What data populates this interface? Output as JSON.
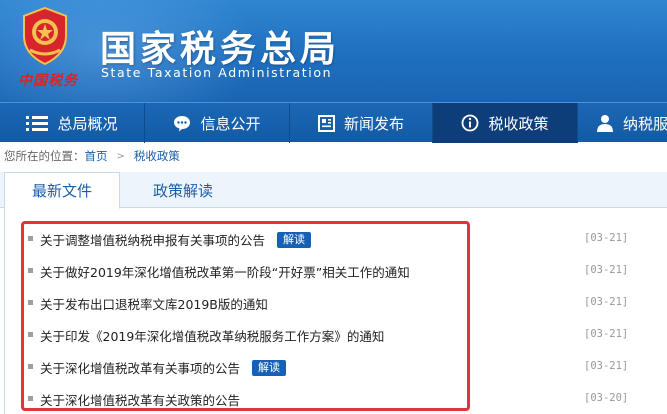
{
  "header": {
    "title": "国家税务总局",
    "subtitle": "State Taxation Administration",
    "emblem_script": "中国税务"
  },
  "nav": {
    "items": [
      {
        "label": "总局概况",
        "icon": "menu-list-icon"
      },
      {
        "label": "信息公开",
        "icon": "chat-bubble-icon"
      },
      {
        "label": "新闻发布",
        "icon": "newspaper-icon"
      },
      {
        "label": "税收政策",
        "icon": "info-circle-icon",
        "active": true
      },
      {
        "label": "纳税服务",
        "icon": "user-icon"
      }
    ]
  },
  "breadcrumb": {
    "prefix": "您所在的位置：",
    "home": "首页",
    "current": "税收政策"
  },
  "tabs": [
    {
      "label": "最新文件",
      "active": true
    },
    {
      "label": "政策解读",
      "active": false
    }
  ],
  "articles": [
    {
      "title": "关于调整增值税纳税申报有关事项的公告",
      "badge": "解读",
      "date": "[03-21]"
    },
    {
      "title": "关于做好2019年深化增值税改革第一阶段“开好票”相关工作的通知",
      "badge": "",
      "date": "[03-21]"
    },
    {
      "title": "关于发布出口退税率文库2019B版的通知",
      "badge": "",
      "date": "[03-21]"
    },
    {
      "title": "关于印发《2019年深化增值税改革纳税服务工作方案》的通知",
      "badge": "",
      "date": "[03-21]"
    },
    {
      "title": "关于深化增值税改革有关事项的公告",
      "badge": "解读",
      "date": "[03-21]"
    },
    {
      "title": "关于深化增值税改革有关政策的公告",
      "badge": "",
      "date": "[03-20]"
    }
  ],
  "colors": {
    "header_blue": "#1f6fbf",
    "nav_blue": "#145aa3",
    "nav_active": "#0d3e7a",
    "highlight_red": "#e0363a",
    "badge_blue": "#1760b5",
    "link_blue": "#1a5fa8"
  }
}
